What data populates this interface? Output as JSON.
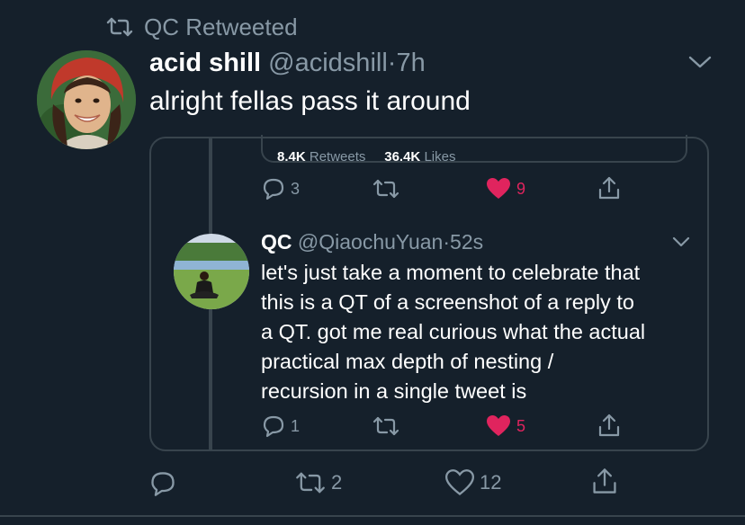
{
  "retweet_header": {
    "text": "QC Retweeted",
    "icon": "retweet-icon"
  },
  "tweet": {
    "display_name": "acid shill",
    "handle": "@acidshill",
    "separator": "·",
    "time": "7h",
    "text": "alright fellas pass it around",
    "actions": {
      "replies": "",
      "retweets": "2",
      "likes": "12"
    }
  },
  "quoted": {
    "inner_stats": {
      "retweets_count": "8.4K",
      "retweets_label": "Retweets",
      "likes_count": "36.4K",
      "likes_label": "Likes"
    },
    "actions": {
      "replies": "3",
      "likes": "9"
    },
    "reply": {
      "display_name": "QC",
      "handle": "@QiaochuYuan",
      "separator": "·",
      "time": "52s",
      "lines": [
        "let's just take a moment to celebrate that",
        "this is a QT of a screenshot of a reply to",
        "a QT. got me real curious what the actual",
        "practical max depth of nesting /",
        "recursion in a single tweet is"
      ],
      "actions": {
        "replies": "1",
        "likes": "5"
      }
    }
  },
  "colors": {
    "background": "#15202b",
    "border": "#38444d",
    "muted": "#8899a6",
    "like": "#e0245e"
  }
}
